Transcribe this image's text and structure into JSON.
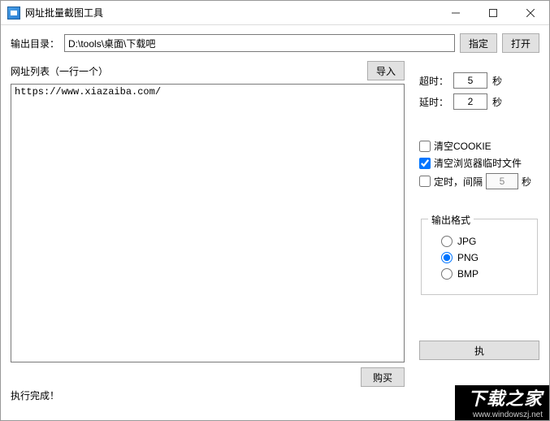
{
  "window": {
    "title": "网址批量截图工具"
  },
  "toolbar": {
    "output_dir_label": "输出目录：",
    "output_dir_value": "D:\\tools\\桌面\\下载吧",
    "choose_label": "指定",
    "open_label": "打开"
  },
  "urllist": {
    "header": "网址列表（一行一个）",
    "import_label": "导入",
    "content": "https://www.xiazaiba.com/"
  },
  "settings": {
    "timeout_label": "超时：",
    "timeout_value": "5",
    "timeout_unit": "秒",
    "delay_label": "延时：",
    "delay_value": "2",
    "delay_unit": "秒",
    "clear_cookie_label": "清空COOKIE",
    "clear_cookie_checked": false,
    "clear_temp_label": "清空浏览器临时文件",
    "clear_temp_checked": true,
    "interval_label": "定时，间隔",
    "interval_checked": false,
    "interval_value": "5",
    "interval_unit": "秒"
  },
  "format": {
    "legend": "输出格式",
    "options": [
      "JPG",
      "PNG",
      "BMP"
    ],
    "selected": "PNG"
  },
  "actions": {
    "buy_label": "购买",
    "start_label": "执"
  },
  "status": {
    "text": "执行完成！"
  },
  "watermark": {
    "big": "下载之家",
    "small": "www.windowszj.net"
  }
}
